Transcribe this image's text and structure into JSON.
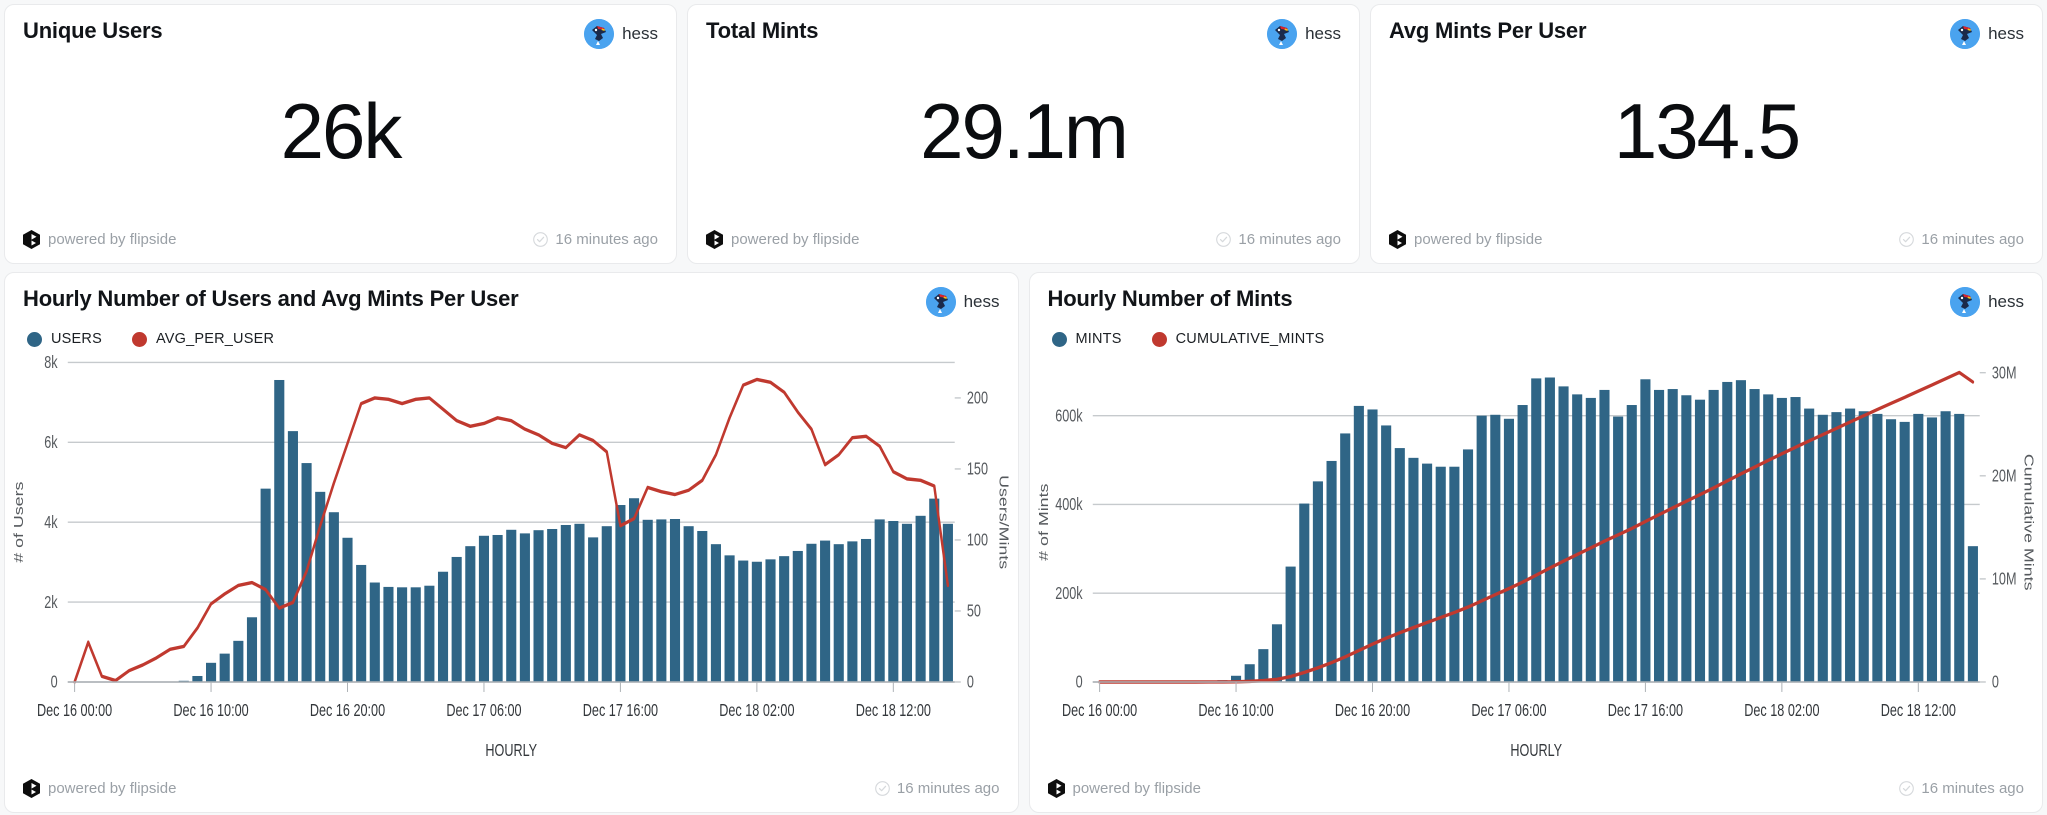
{
  "theme": {
    "bar_color": "#2f6586",
    "line_color": "#c0392f",
    "card_bg": "#ffffff",
    "page_bg": "#f7f8f9",
    "muted_text": "#9aa0a6"
  },
  "kpi_cards": [
    {
      "title": "Unique Users",
      "value": "26k",
      "owner": "hess",
      "brand": "powered by flipside",
      "updated": "16 minutes ago"
    },
    {
      "title": "Total Mints",
      "value": "29.1m",
      "owner": "hess",
      "brand": "powered by flipside",
      "updated": "16 minutes ago"
    },
    {
      "title": "Avg Mints Per User",
      "value": "134.5",
      "owner": "hess",
      "brand": "powered by flipside",
      "updated": "16 minutes ago"
    }
  ],
  "chart_cards": [
    {
      "title": "Hourly Number of Users and Avg Mints Per User",
      "owner": "hess",
      "brand": "powered by flipside",
      "updated": "16 minutes ago"
    },
    {
      "title": "Hourly Number of Mints",
      "owner": "hess",
      "brand": "powered by flipside",
      "updated": "16 minutes ago"
    }
  ],
  "chart_data": [
    {
      "type": "bar",
      "title": "Hourly Number of Users and Avg Mints Per User",
      "xlabel": "HOURLY",
      "ylabel": "# of Users",
      "y2label": "Users/Mints",
      "grid": true,
      "legend_position": "top-left",
      "ylim": [
        0,
        8000
      ],
      "y2lim": [
        0,
        225
      ],
      "yticks": [
        0,
        2000,
        4000,
        6000,
        8000
      ],
      "ytick_labels": [
        "0",
        "2k",
        "4k",
        "6k",
        "8k"
      ],
      "y2ticks": [
        0,
        50,
        100,
        150,
        200
      ],
      "y2tick_labels": [
        "0",
        "50",
        "100",
        "150",
        "200"
      ],
      "xtick_labels": [
        "Dec 16 00:00",
        "Dec 16 10:00",
        "Dec 16 20:00",
        "Dec 17 06:00",
        "Dec 17 16:00",
        "Dec 18 02:00",
        "Dec 18 12:00"
      ],
      "xtick_indices": [
        0,
        10,
        20,
        30,
        40,
        50,
        60
      ],
      "series": [
        {
          "name": "USERS",
          "kind": "bar",
          "axis": "left",
          "color": "#2f6586",
          "values": [
            0,
            0,
            0,
            0,
            0,
            0,
            0,
            0,
            30,
            150,
            480,
            710,
            1030,
            1620,
            4840,
            7560,
            6280,
            5480,
            4760,
            4250,
            3610,
            2930,
            2490,
            2380,
            2370,
            2370,
            2410,
            2760,
            3130,
            3400,
            3660,
            3680,
            3810,
            3720,
            3800,
            3830,
            3930,
            3960,
            3620,
            3900,
            4430,
            4600,
            4060,
            4070,
            4080,
            3900,
            3780,
            3450,
            3170,
            3040,
            3010,
            3070,
            3150,
            3280,
            3460,
            3540,
            3450,
            3520,
            3580,
            4070,
            4030,
            3960,
            4160,
            4590,
            3960
          ]
        },
        {
          "name": "AVG_PER_USER",
          "kind": "line",
          "axis": "right",
          "color": "#c0392f",
          "values": [
            0,
            28,
            4,
            1,
            8,
            12,
            17,
            23,
            25,
            38,
            55,
            62,
            68,
            70,
            65,
            52,
            56,
            78,
            110,
            140,
            168,
            196,
            200,
            199,
            196,
            199,
            200,
            192,
            184,
            180,
            182,
            186,
            184,
            178,
            174,
            168,
            165,
            174,
            170,
            162,
            110,
            115,
            137,
            134,
            132,
            135,
            142,
            160,
            186,
            209,
            213,
            211,
            204,
            190,
            178,
            153,
            160,
            172,
            173,
            166,
            148,
            143,
            142,
            138,
            68
          ]
        }
      ]
    },
    {
      "type": "bar",
      "title": "Hourly Number of Mints",
      "xlabel": "HOURLY",
      "ylabel": "# of Mints",
      "y2label": "Cumulative Mints",
      "grid": true,
      "legend_position": "top-left",
      "ylim": [
        0,
        720000
      ],
      "y2lim": [
        0,
        31000000
      ],
      "yticks": [
        0,
        200000,
        400000,
        600000
      ],
      "ytick_labels": [
        "0",
        "200k",
        "400k",
        "600k"
      ],
      "y2ticks": [
        0,
        10000000,
        20000000,
        30000000
      ],
      "y2tick_labels": [
        "0",
        "10M",
        "20M",
        "30M"
      ],
      "xtick_labels": [
        "Dec 16 00:00",
        "Dec 16 10:00",
        "Dec 16 20:00",
        "Dec 17 06:00",
        "Dec 17 16:00",
        "Dec 18 02:00",
        "Dec 18 12:00"
      ],
      "xtick_indices": [
        0,
        10,
        20,
        30,
        40,
        50,
        60
      ],
      "series": [
        {
          "name": "MINTS",
          "kind": "bar",
          "axis": "left",
          "color": "#2f6586",
          "values": [
            0,
            0,
            0,
            0,
            0,
            0,
            0,
            0,
            1000,
            4000,
            14000,
            40000,
            74000,
            130000,
            260000,
            402000,
            452000,
            498000,
            560000,
            622000,
            614000,
            578000,
            527000,
            505000,
            492000,
            485000,
            485000,
            524000,
            600000,
            602000,
            593000,
            624000,
            684000,
            686000,
            666000,
            648000,
            640000,
            658000,
            598000,
            624000,
            682000,
            658000,
            660000,
            646000,
            636000,
            658000,
            676000,
            680000,
            660000,
            648000,
            640000,
            642000,
            616000,
            602000,
            608000,
            616000,
            610000,
            604000,
            592000,
            586000,
            604000,
            596000,
            610000,
            604000,
            306000
          ]
        },
        {
          "name": "CUMULATIVE_MINTS",
          "kind": "line",
          "axis": "right",
          "color": "#c0392f",
          "values": [
            0,
            0,
            0,
            0,
            0,
            0,
            0,
            0,
            1000,
            5000,
            19000,
            59000,
            133000,
            263000,
            523000,
            925000,
            1377000,
            1875000,
            2435000,
            3057000,
            3671000,
            4249000,
            4776000,
            5281000,
            5773000,
            6258000,
            6743000,
            7267000,
            7867000,
            8469000,
            9062000,
            9686000,
            10370000,
            11056000,
            11722000,
            12370000,
            13010000,
            13668000,
            14266000,
            14890000,
            15572000,
            16230000,
            16890000,
            17536000,
            18172000,
            18830000,
            19506000,
            20186000,
            20846000,
            21494000,
            22134000,
            22776000,
            23392000,
            23994000,
            24602000,
            25218000,
            25828000,
            26432000,
            27024000,
            27610000,
            28214000,
            28810000,
            29420000,
            30024000,
            29100000
          ]
        }
      ]
    }
  ],
  "icons": {
    "avatar": "jayhawk-avatar-icon",
    "brand_mark": "flipside-logo-icon",
    "freshness": "check-circle-icon"
  }
}
